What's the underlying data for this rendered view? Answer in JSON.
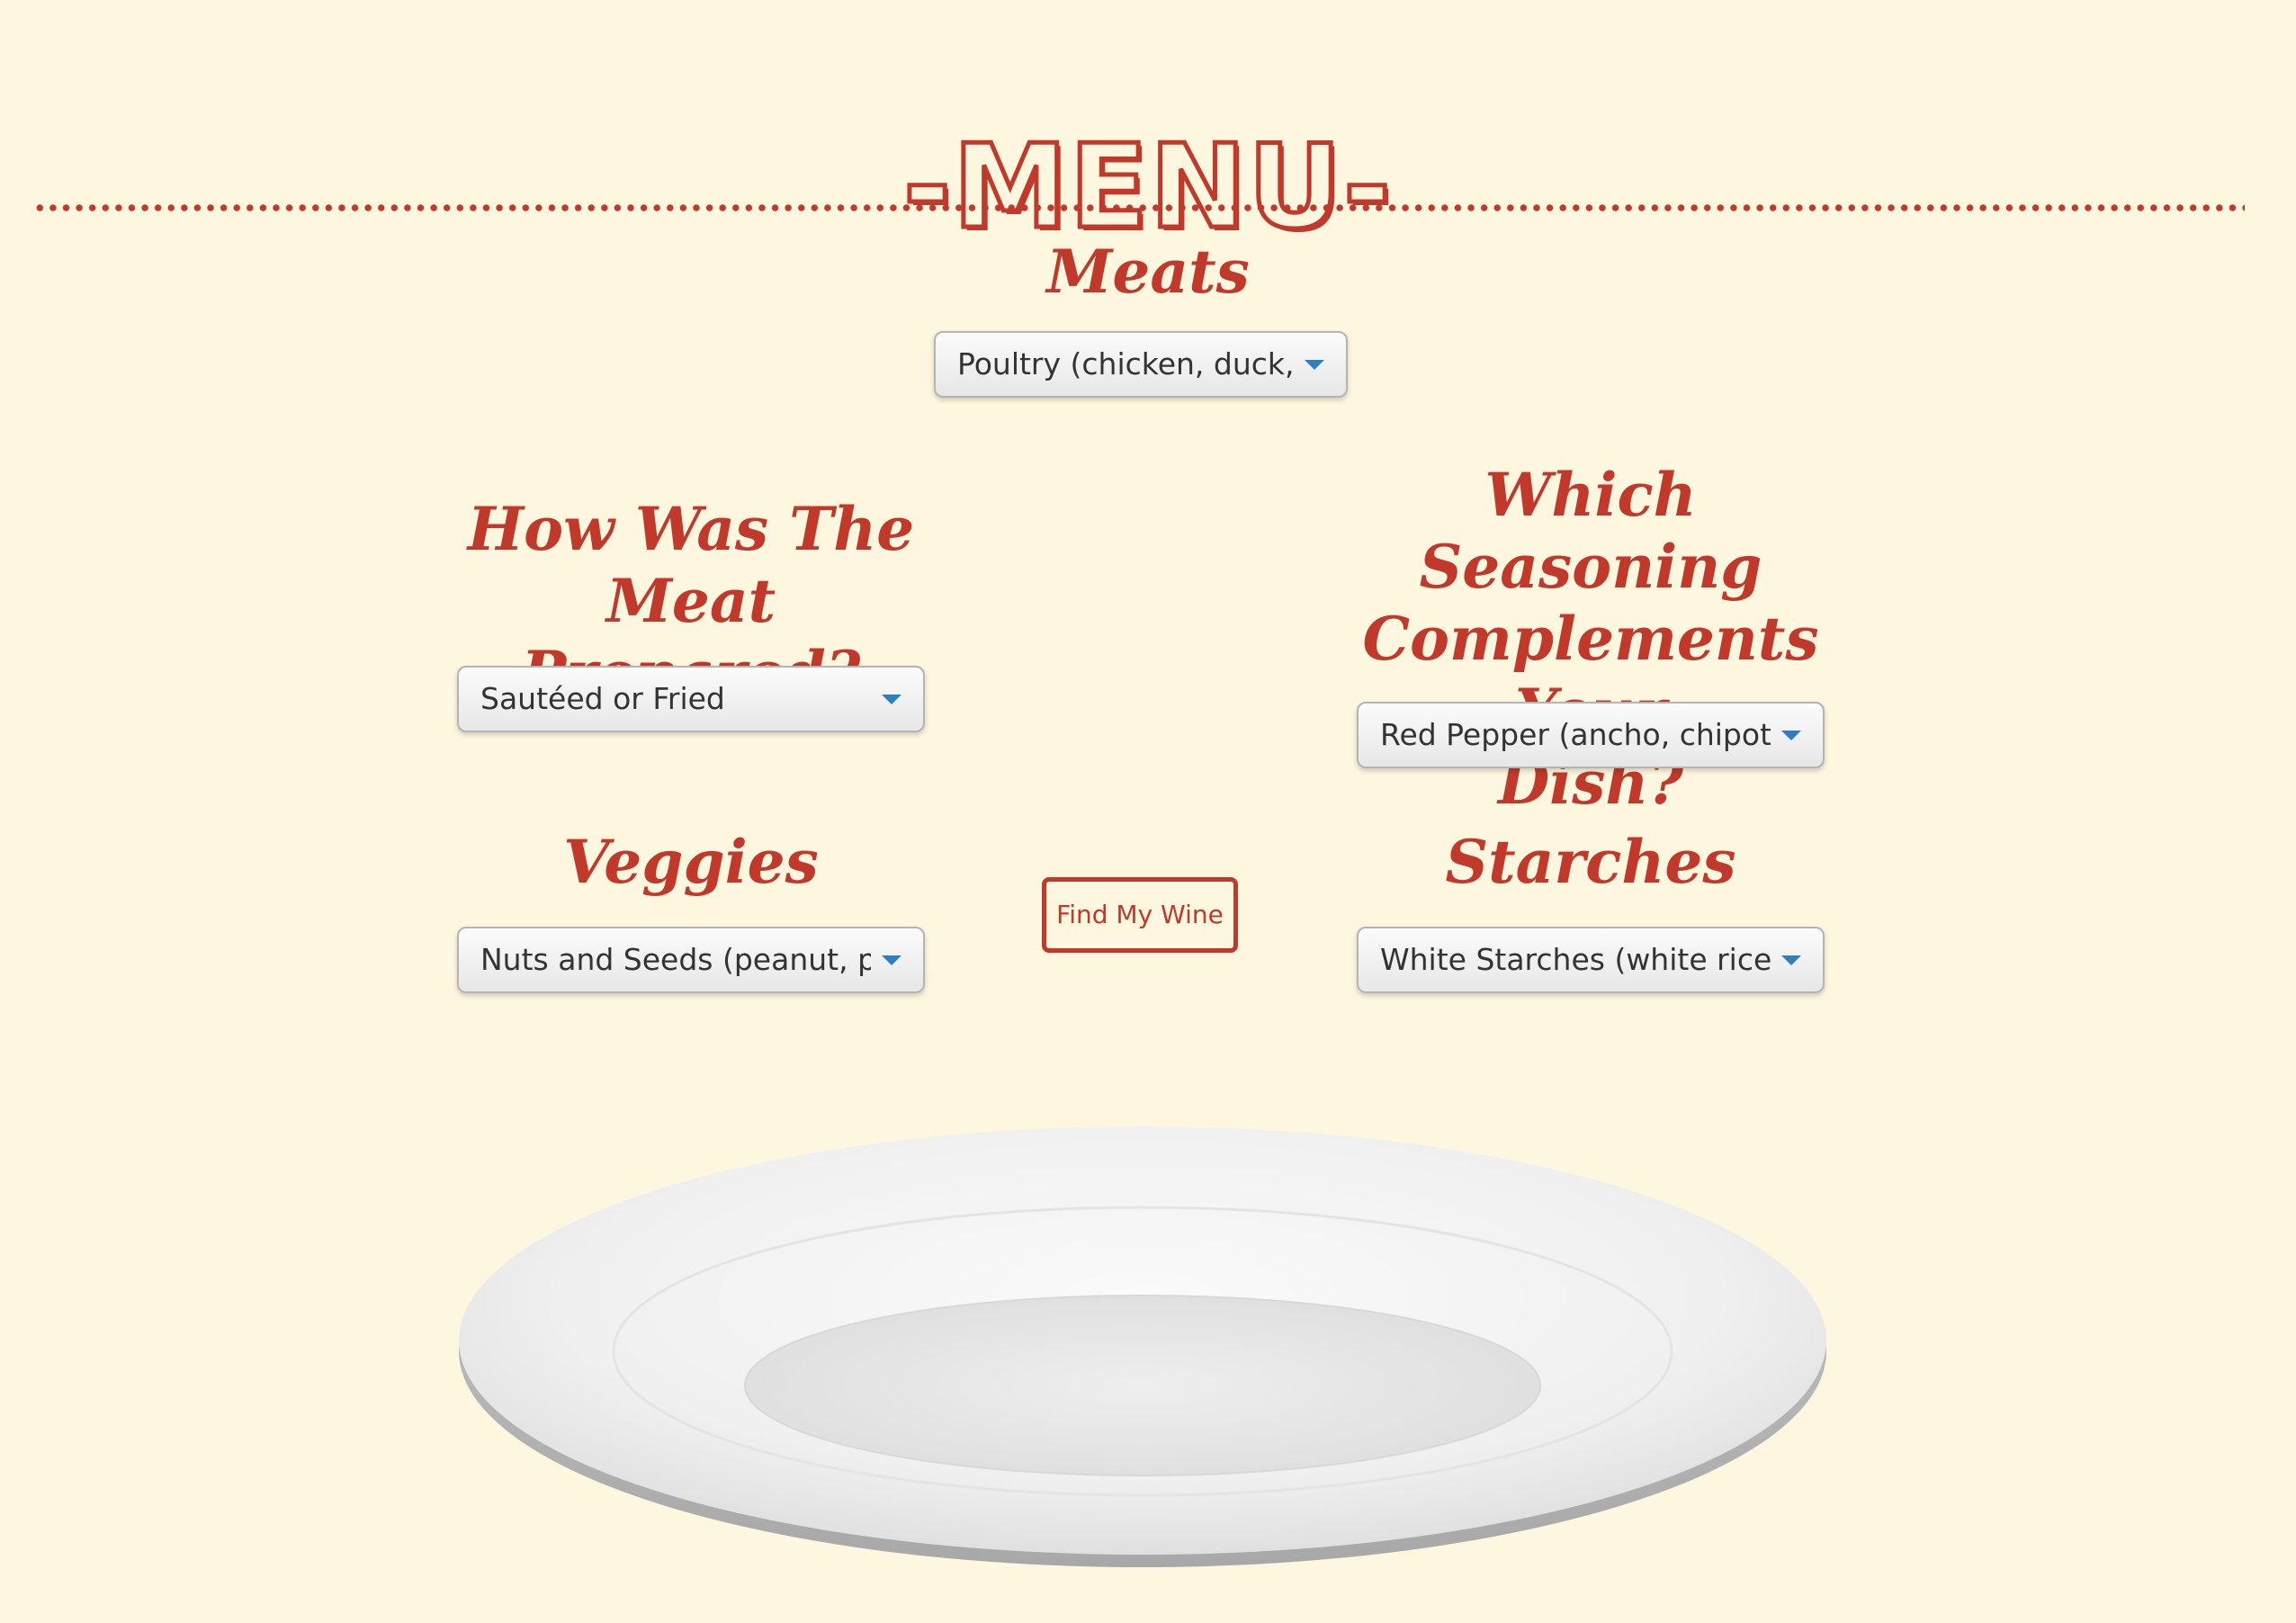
{
  "header": {
    "title": "-MENU-"
  },
  "sections": {
    "meats": {
      "heading": "Meats",
      "selected": "Poultry (chicken, duck, turkey)"
    },
    "preparation": {
      "heading_line1": "How Was The Meat",
      "heading_line2": "Prepared?",
      "selected": "Sautéed or Fried"
    },
    "seasoning": {
      "heading_line1": "Which Seasoning",
      "heading_line2": "Complements Your",
      "heading_line3": "Dish?",
      "selected": "Red Pepper (ancho, chipotle, cayenne)"
    },
    "veggies": {
      "heading": "Veggies",
      "selected": "Nuts and Seeds (peanut, pecan)"
    },
    "starches": {
      "heading": "Starches",
      "selected": "White Starches (white rice, pasta)"
    }
  },
  "actions": {
    "find_wine_label": "Find My Wine"
  },
  "colors": {
    "background": "#fef7df",
    "accent": "#c0392b",
    "dropdown_arrow": "#2e7fbf"
  },
  "icons": {
    "dropdown": "chevron-down-icon",
    "plate": "plate-illustration"
  }
}
